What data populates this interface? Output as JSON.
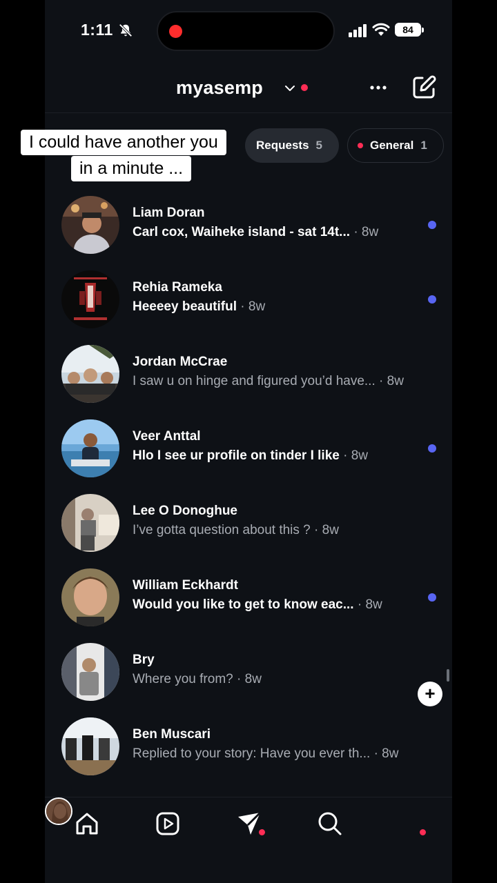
{
  "status": {
    "time": "1:11",
    "battery": "84"
  },
  "header": {
    "username": "myasemp"
  },
  "filters": [
    {
      "label": "Requests",
      "count": "5"
    },
    {
      "label": "General",
      "count": "1"
    }
  ],
  "caption": {
    "line1": "I could have another you",
    "line2": "in a minute ..."
  },
  "threads": [
    {
      "name": "Liam Doran",
      "preview": "Carl cox, Waiheke island - sat 14t...",
      "time": "· 8w",
      "unread": true
    },
    {
      "name": "Rehia Rameka",
      "preview": "Heeeey beautiful",
      "time": "· 8w",
      "unread": true
    },
    {
      "name": "Jordan McCrae",
      "preview": "I saw u on hinge and figured you’d have...",
      "time": "· 8w",
      "unread": false
    },
    {
      "name": "Veer Anttal",
      "preview": "Hlo I see ur profile on tinder I like",
      "time": "· 8w",
      "unread": true
    },
    {
      "name": "Lee O Donoghue",
      "preview": "I’ve gotta question about this ?",
      "time": "· 8w",
      "unread": false
    },
    {
      "name": "William Eckhardt",
      "preview": "Would you like to get to know eac...",
      "time": "· 8w",
      "unread": true
    },
    {
      "name": "Bry",
      "preview": "Where you from?",
      "time": "· 8w",
      "unread": false
    },
    {
      "name": "Ben Muscari",
      "preview": "Replied to your story: Have you ever th...",
      "time": "· 8w",
      "unread": false
    }
  ],
  "colors": {
    "background": "#0e1116",
    "unread_dot": "#5865f2",
    "accent_red": "#ff2d55"
  }
}
